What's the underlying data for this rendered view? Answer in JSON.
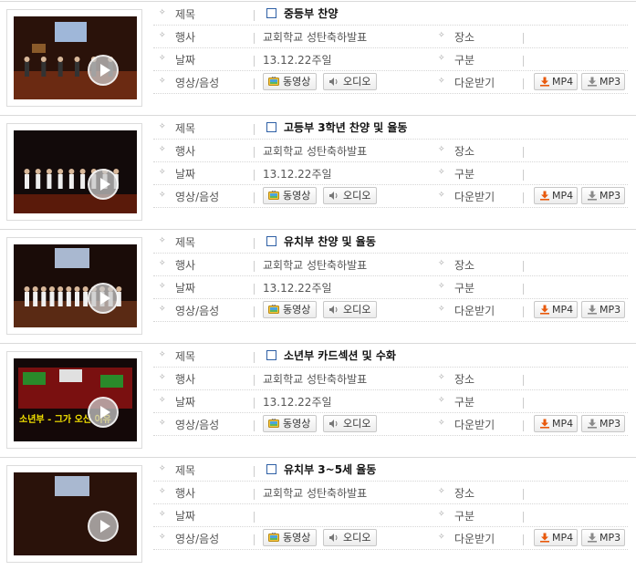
{
  "labels": {
    "title": "제목",
    "event": "행사",
    "date": "날짜",
    "media": "영상/음성",
    "place": "장소",
    "category": "구분",
    "download": "다운받기"
  },
  "buttons": {
    "video": "동영상",
    "audio": "오디오",
    "mp4": "MP4",
    "mp3": "MP3"
  },
  "icons": {
    "bullet": "crosshair-bullet-icon",
    "play": "play-icon",
    "video": "tv-icon",
    "audio": "speaker-icon",
    "download": "download-arrow-icon"
  },
  "colors": {
    "checkbox": "#2e5fa5",
    "download_orange": "#e8590c",
    "download_gray": "#8a8a8a"
  },
  "items": [
    {
      "title": "중등부 찬양",
      "event": "교회학교 성탄축하발표",
      "date": "13.12.22주일",
      "place": "",
      "category": ""
    },
    {
      "title": "고등부 3학년 찬양 및 율동",
      "event": "교회학교 성탄축하발표",
      "date": "13.12.22주일",
      "place": "",
      "category": ""
    },
    {
      "title": "유치부 찬양 및 율동",
      "event": "교회학교 성탄축하발표",
      "date": "13.12.22주일",
      "place": "",
      "category": ""
    },
    {
      "title": "소년부 카드섹션 및 수화",
      "event": "교회학교 성탄축하발표",
      "date": "13.12.22주일",
      "place": "",
      "category": "",
      "thumb_caption": "소년부 - 그가 오신 이유"
    },
    {
      "title": "유치부 3~5세 율동",
      "event": "교회학교 성탄축하발표",
      "date": "",
      "place": "",
      "category": ""
    }
  ]
}
